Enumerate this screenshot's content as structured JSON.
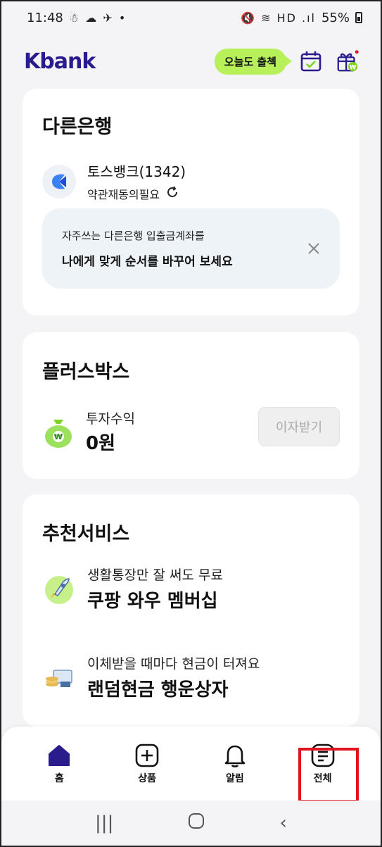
{
  "status_bar": {
    "time": "11:48",
    "battery": "55%"
  },
  "header": {
    "logo": "Kbank",
    "attend_label": "오늘도 출첵"
  },
  "other_bank": {
    "title": "다른은행",
    "bank_name": "토스뱅크(1342)",
    "bank_status": "약관재동의필요",
    "tip_small": "자주쓰는 다른은행 입출금계좌를",
    "tip_big": "나에게 맞게 순서를 바꾸어 보세요"
  },
  "plus_box": {
    "title": "플러스박스",
    "label": "투자수익",
    "value": "0원",
    "button": "이자받기"
  },
  "recommend": {
    "title": "추천서비스",
    "items": [
      {
        "sub": "생활통장만 잘 써도 무료",
        "main": "쿠팡 와우 멤버십"
      },
      {
        "sub": "이체받을 때마다 현금이 터져요",
        "main": "랜덤현금 행운상자"
      }
    ]
  },
  "bottom_nav": [
    {
      "label": "홈"
    },
    {
      "label": "상품"
    },
    {
      "label": "알림"
    },
    {
      "label": "전체"
    }
  ],
  "colors": {
    "brand": "#2a1c8c",
    "accent": "#b8f05a",
    "highlight": "#e0141e"
  }
}
